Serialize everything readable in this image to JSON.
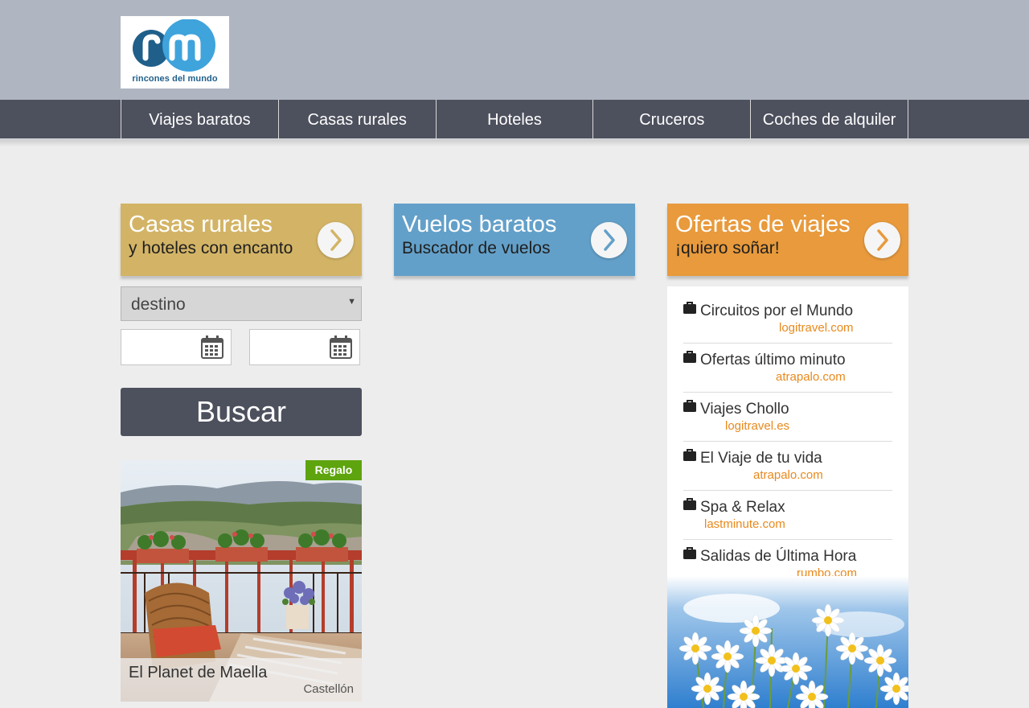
{
  "brand": {
    "logo_text": "rincones del mundo"
  },
  "nav": {
    "items": [
      {
        "label": "Viajes baratos"
      },
      {
        "label": "Casas rurales"
      },
      {
        "label": "Hoteles"
      },
      {
        "label": "Cruceros"
      },
      {
        "label": "Coches de alquiler"
      }
    ]
  },
  "cards": {
    "casas": {
      "title": "Casas rurales",
      "subtitle": "y hoteles con encanto"
    },
    "vuelos": {
      "title": "Vuelos baratos",
      "subtitle": "Buscador de vuelos"
    },
    "ofertas": {
      "title": "Ofertas de viajes",
      "subtitle": "¡quiero soñar!"
    }
  },
  "search": {
    "destination_value": "destino",
    "button_label": "Buscar"
  },
  "promo": {
    "badge": "Regalo",
    "title": "El Planet de Maella",
    "location": "Castellón"
  },
  "offers": [
    {
      "title": "Circuitos por el Mundo",
      "source": "logitravel.com"
    },
    {
      "title": "Ofertas último minuto",
      "source": "atrapalo.com"
    },
    {
      "title": "Viajes Chollo",
      "source": "logitravel.es"
    },
    {
      "title": "El Viaje de tu vida",
      "source": "atrapalo.com"
    },
    {
      "title": "Spa & Relax",
      "source": "lastminute.com"
    },
    {
      "title": "Salidas de Última Hora",
      "source": "rumbo.com"
    }
  ],
  "icons": {
    "card_arrow": "chevron-right-icon",
    "date": "calendar-icon",
    "offer": "briefcase-icon"
  },
  "colors": {
    "header_bg": "#afb5c1",
    "nav_bg": "#4d505d",
    "casas": "#d3b466",
    "vuelos": "#63a0c9",
    "ofertas": "#e89a3c",
    "badge": "#5ea40e",
    "offer_source": "#e8891c"
  }
}
